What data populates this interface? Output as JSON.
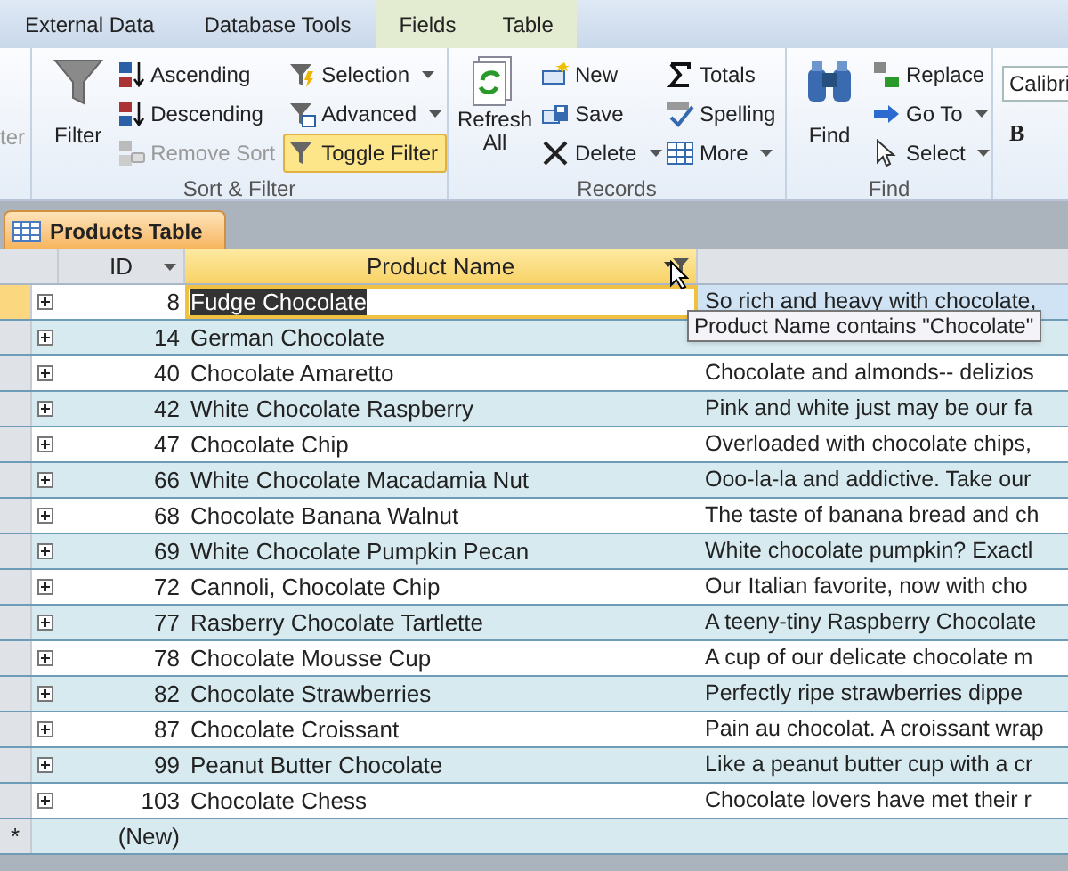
{
  "ribbon_tabs": [
    {
      "label": "External Data",
      "contextual": false
    },
    {
      "label": "Database Tools",
      "contextual": false
    },
    {
      "label": "Fields",
      "contextual": true
    },
    {
      "label": "Table",
      "contextual": true
    }
  ],
  "cut_group_label": "ter",
  "sort_filter": {
    "label": "Sort & Filter",
    "filter": "Filter",
    "sort_buttons": [
      {
        "kind": "ascending",
        "label": "Ascending",
        "disabled": false
      },
      {
        "kind": "descending",
        "label": "Descending",
        "disabled": false
      },
      {
        "kind": "remove",
        "label": "Remove Sort",
        "disabled": true
      }
    ],
    "filter_buttons": [
      {
        "kind": "selection",
        "label": "Selection",
        "dropdown": true,
        "active": false
      },
      {
        "kind": "advanced",
        "label": "Advanced",
        "dropdown": true,
        "active": false
      },
      {
        "kind": "toggle",
        "label": "Toggle Filter",
        "dropdown": false,
        "active": true
      }
    ]
  },
  "records": {
    "label": "Records",
    "refresh": "Refresh All",
    "columns": [
      [
        {
          "kind": "new",
          "label": "New"
        },
        {
          "kind": "save",
          "label": "Save"
        },
        {
          "kind": "delete",
          "label": "Delete",
          "dropdown": true
        }
      ],
      [
        {
          "kind": "totals",
          "label": "Totals"
        },
        {
          "kind": "spelling",
          "label": "Spelling"
        },
        {
          "kind": "more",
          "label": "More",
          "dropdown": true
        }
      ]
    ]
  },
  "find": {
    "label": "Find",
    "find": "Find",
    "buttons": [
      {
        "kind": "replace",
        "label": "Replace"
      },
      {
        "kind": "goto",
        "label": "Go To",
        "dropdown": true
      },
      {
        "kind": "select",
        "label": "Select",
        "dropdown": true
      }
    ]
  },
  "text_formatting": {
    "font": "Calibri",
    "bold": "B"
  },
  "document_tab": "Products Table",
  "table": {
    "columns": [
      {
        "label": "ID",
        "filtered": false
      },
      {
        "label": "Product Name",
        "filtered": true
      }
    ],
    "rows": [
      {
        "id": "8",
        "name": "Fudge Chocolate",
        "description": "So rich and heavy with chocolate,",
        "current": true
      },
      {
        "id": "14",
        "name": "German Chocolate",
        "current": false
      },
      {
        "id": "40",
        "name": "Chocolate Amaretto",
        "description": "Chocolate and almonds-- delizios",
        "current": false
      },
      {
        "id": "42",
        "name": "White Chocolate Raspberry",
        "description": "Pink and white just may be our fa",
        "current": false
      },
      {
        "id": "47",
        "name": "Chocolate Chip",
        "description": "Overloaded with chocolate chips,",
        "current": false
      },
      {
        "id": "66",
        "name": "White Chocolate Macadamia Nut",
        "description": "Ooo-la-la and addictive. Take our",
        "current": false
      },
      {
        "id": "68",
        "name": "Chocolate Banana Walnut",
        "description": "The taste of banana bread and ch",
        "current": false
      },
      {
        "id": "69",
        "name": "White Chocolate Pumpkin Pecan",
        "description": "White chocolate pumpkin? Exactl",
        "current": false
      },
      {
        "id": "72",
        "name": "Cannoli, Chocolate Chip",
        "description": "Our Italian favorite, now with cho",
        "current": false
      },
      {
        "id": "77",
        "name": "Rasberry Chocolate Tartlette",
        "description": "A teeny-tiny Raspberry Chocolate",
        "current": false
      },
      {
        "id": "78",
        "name": "Chocolate Mousse Cup",
        "description": "A cup of our delicate chocolate m",
        "current": false
      },
      {
        "id": "82",
        "name": "Chocolate Strawberries",
        "description": "Perfectly ripe strawberries dippe",
        "current": false
      },
      {
        "id": "87",
        "name": "Chocolate Croissant",
        "description": "Pain au chocolat. A croissant wrap",
        "current": false
      },
      {
        "id": "99",
        "name": "Peanut Butter Chocolate",
        "description": "Like a peanut butter cup with a cr",
        "current": false
      },
      {
        "id": "103",
        "name": "Chocolate Chess",
        "description": "Chocolate lovers have met their r",
        "current": false
      }
    ],
    "new_row": {
      "marker": "*",
      "label": "(New)"
    }
  },
  "tooltip": "Product Name contains \"Chocolate\""
}
